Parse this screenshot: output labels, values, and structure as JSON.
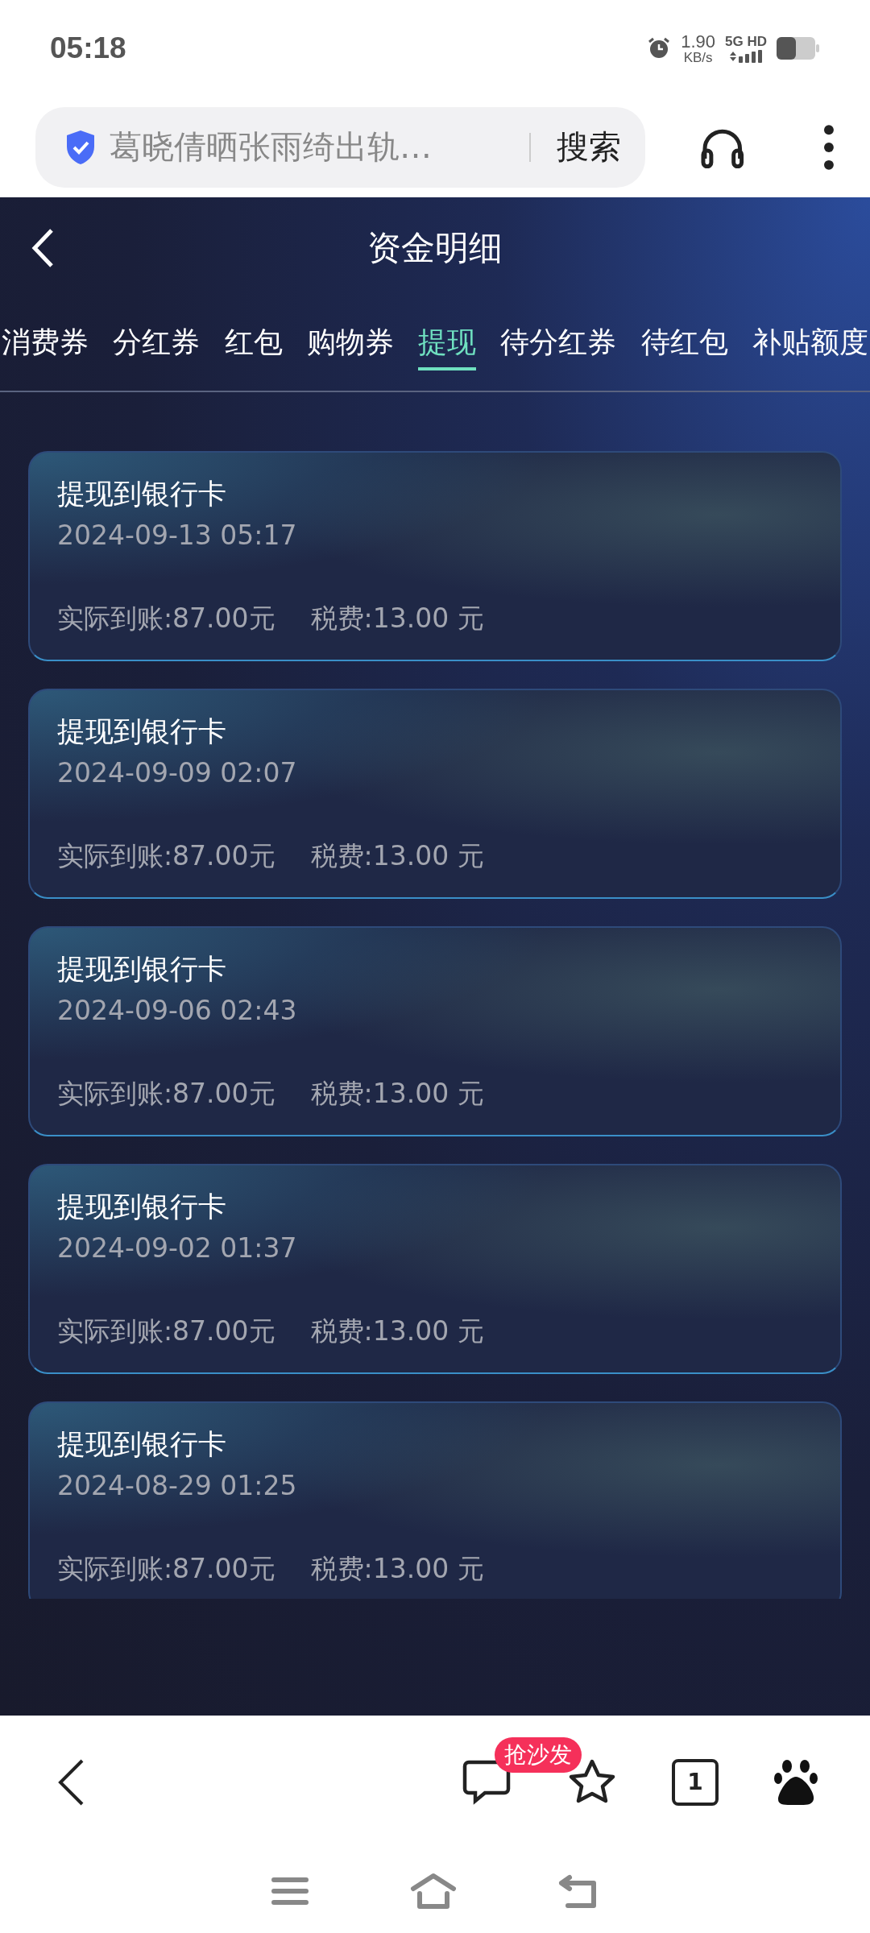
{
  "status_bar": {
    "time": "05:18",
    "net_speed": "1.90",
    "net_unit": "KB/s",
    "network": "5G HD"
  },
  "browser_bar": {
    "query": "葛晓倩晒张雨绮出轨…",
    "search_button": "搜索"
  },
  "header": {
    "title": "资金明细"
  },
  "tabs": [
    {
      "label": "消费券",
      "selected": false
    },
    {
      "label": "分红券",
      "selected": false
    },
    {
      "label": "红包",
      "selected": false
    },
    {
      "label": "购物券",
      "selected": false
    },
    {
      "label": "提现",
      "selected": true
    },
    {
      "label": "待分红券",
      "selected": false
    },
    {
      "label": "待红包",
      "selected": false
    },
    {
      "label": "补贴额度",
      "selected": false
    }
  ],
  "records": [
    {
      "title": "提现到银行卡",
      "time": "2024-09-13 05:17",
      "received": "实际到账:87.00元",
      "fee": "税费:13.00 元"
    },
    {
      "title": "提现到银行卡",
      "time": "2024-09-09 02:07",
      "received": "实际到账:87.00元",
      "fee": "税费:13.00 元"
    },
    {
      "title": "提现到银行卡",
      "time": "2024-09-06 02:43",
      "received": "实际到账:87.00元",
      "fee": "税费:13.00 元"
    },
    {
      "title": "提现到银行卡",
      "time": "2024-09-02 01:37",
      "received": "实际到账:87.00元",
      "fee": "税费:13.00 元"
    },
    {
      "title": "提现到银行卡",
      "time": "2024-08-29 01:25",
      "received": "实际到账:87.00元",
      "fee": "税费:13.00 元"
    }
  ],
  "bottom_toolbar": {
    "comment_badge": "抢沙发",
    "tab_count": "1"
  }
}
